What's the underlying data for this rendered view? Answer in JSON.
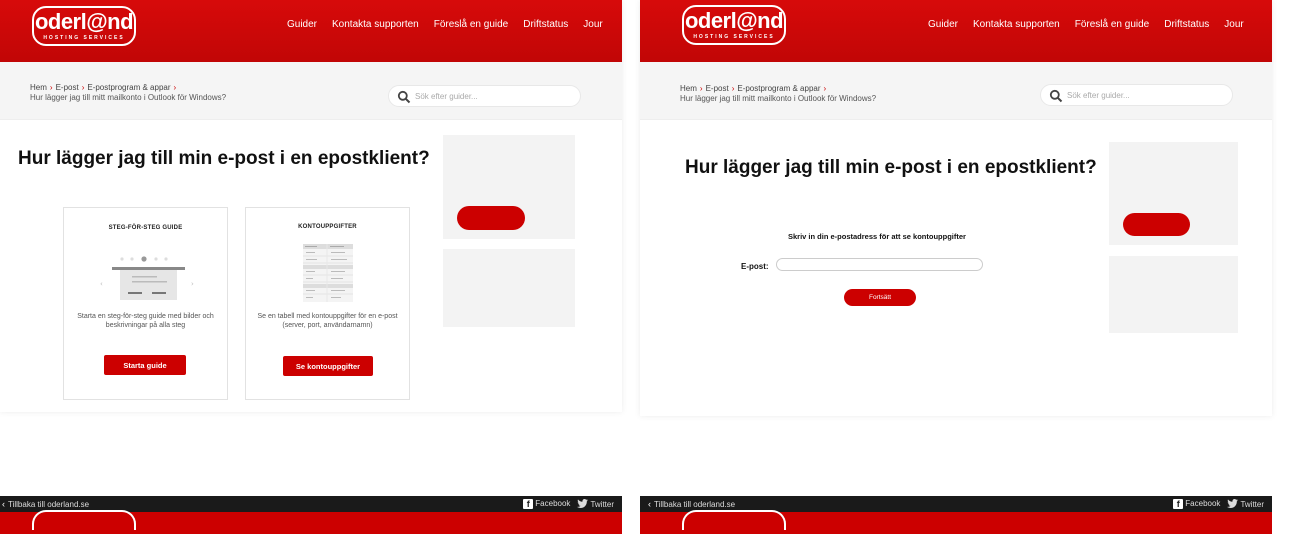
{
  "brand": {
    "logo_word": "oderl@nd",
    "logo_tagline": "HOSTING SERVICES",
    "accent": "#cc0000"
  },
  "nav": {
    "items": [
      "Guider",
      "Kontakta supporten",
      "Föreslå en guide",
      "Driftstatus",
      "Jour"
    ]
  },
  "breadcrumb": {
    "items": [
      "Hem",
      "E-post",
      "E-postprogram & appar"
    ],
    "current": "Hur lägger jag till mitt mailkonto i Outlook för Windows?"
  },
  "search": {
    "placeholder": "Sök efter guider..."
  },
  "page": {
    "title": "Hur lägger jag till min e-post i en epostklient?"
  },
  "guide_card": {
    "heading": "STEG-FÖR-STEG GUIDE",
    "description": "Starta en steg-för-steg guide med bilder och beskrivningar på alla steg",
    "button": "Starta guide"
  },
  "account_card": {
    "heading": "KONTOUPPGIFTER",
    "description": "Se en tabell med kontouppgifter för en e-post (server, port, användarnamn)",
    "button": "Se kontouppgifter"
  },
  "email_form": {
    "heading": "Skriv in din e-postadress för att se kontouppgifter",
    "label": "E-post:",
    "value": "",
    "button": "Fortsätt"
  },
  "topbar": {
    "back_link": "Tillbaka till oderland.se",
    "facebook": "Facebook",
    "twitter": "Twitter"
  }
}
